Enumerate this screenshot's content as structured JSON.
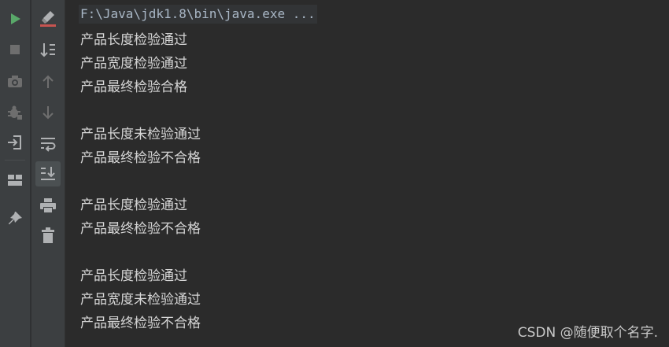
{
  "command": "F:\\Java\\jdk1.8\\bin\\java.exe ...",
  "output_lines": [
    "产品长度检验通过",
    "产品宽度检验通过",
    "产品最终检验合格",
    "",
    "产品长度未检验通过",
    "产品最终检验不合格",
    "",
    "产品长度检验通过",
    "产品最终检验不合格",
    "",
    "产品长度检验通过",
    "产品宽度未检验通过",
    "产品最终检验不合格"
  ],
  "left_toolbar": [
    {
      "name": "rerun-icon",
      "color": "#59a869"
    },
    {
      "name": "stop-icon",
      "color": "#6e6e6e"
    },
    {
      "name": "camera-icon",
      "color": "#6e6e6e"
    },
    {
      "name": "debug-bug-icon",
      "color": "#6e6e6e"
    },
    {
      "name": "exit-icon",
      "color": "#afb1b3"
    },
    {
      "name": "layout-icon",
      "color": "#afb1b3"
    },
    {
      "name": "pin-icon",
      "color": "#afb1b3"
    }
  ],
  "right_toolbar": [
    {
      "name": "clear-all-icon",
      "color": "#afb1b3",
      "accent": "#c75450"
    },
    {
      "name": "sort-down-icon",
      "color": "#afb1b3"
    },
    {
      "name": "up-arrow-icon",
      "color": "#6e6e6e"
    },
    {
      "name": "down-arrow-icon",
      "color": "#6e6e6e"
    },
    {
      "name": "soft-wrap-icon",
      "color": "#afb1b3"
    },
    {
      "name": "scroll-to-end-icon",
      "color": "#afb1b3"
    },
    {
      "name": "print-icon",
      "color": "#afb1b3"
    },
    {
      "name": "trash-icon",
      "color": "#afb1b3"
    }
  ],
  "watermark": "CSDN @随便取个名字."
}
